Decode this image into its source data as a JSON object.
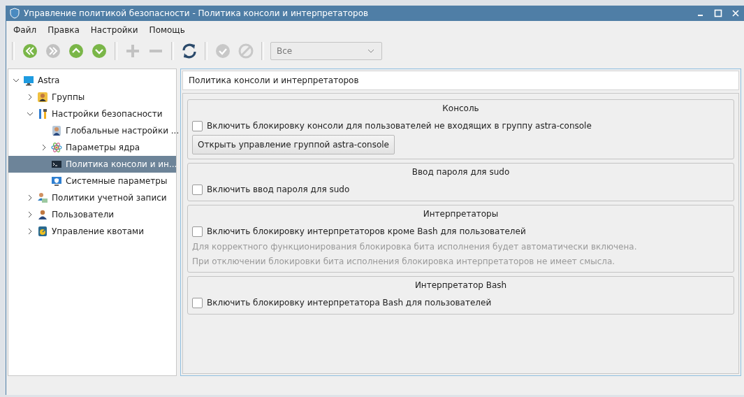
{
  "window": {
    "title": "Управление политикой безопасности - Политика консоли и интерпретаторов"
  },
  "menu": [
    "Файл",
    "Правка",
    "Настройки",
    "Помощь"
  ],
  "toolbar": [
    {
      "kind": "first",
      "disabled": false
    },
    {
      "kind": "next",
      "disabled": true
    },
    {
      "kind": "up",
      "disabled": false
    },
    {
      "kind": "down",
      "disabled": false
    },
    {
      "kind": "sep"
    },
    {
      "kind": "add",
      "disabled": true
    },
    {
      "kind": "remove",
      "disabled": true
    },
    {
      "kind": "sep"
    },
    {
      "kind": "refresh",
      "disabled": false
    },
    {
      "kind": "sep"
    },
    {
      "kind": "apply",
      "disabled": true
    },
    {
      "kind": "cancel",
      "disabled": true
    },
    {
      "kind": "sep"
    }
  ],
  "filter": {
    "value": "Все"
  },
  "tree": [
    {
      "label": "Astra",
      "kind": "monitor",
      "expanded": true,
      "selected": false,
      "children": [
        {
          "label": "Группы",
          "kind": "group",
          "expanded": false,
          "selected": false
        },
        {
          "label": "Настройки безопасности",
          "kind": "tools",
          "expanded": true,
          "selected": false,
          "children": [
            {
              "label": "Глобальные настройки ...",
              "kind": "person",
              "selected": false
            },
            {
              "label": "Параметры ядра",
              "kind": "atom",
              "expanded": false,
              "selected": false
            },
            {
              "label": "Политика консоли и ин...",
              "kind": "terminal",
              "selected": true
            },
            {
              "label": "Системные параметры",
              "kind": "shield",
              "selected": false
            }
          ]
        },
        {
          "label": "Политики учетной записи",
          "kind": "account",
          "expanded": false,
          "selected": false
        },
        {
          "label": "Пользователи",
          "kind": "users",
          "expanded": false,
          "selected": false
        },
        {
          "label": "Управление квотами",
          "kind": "quota",
          "expanded": false,
          "selected": false
        }
      ]
    }
  ],
  "page_title": "Политика консоли и интерпретаторов",
  "sections": [
    {
      "title": "Консоль",
      "items": [
        {
          "kind": "checkbox",
          "label": "Включить блокировку консоли для пользователей не входящих в группу astra-console",
          "checked": false
        },
        {
          "kind": "button",
          "label": "Открыть управление группой astra-console"
        }
      ]
    },
    {
      "title": "Ввод пароля для sudo",
      "items": [
        {
          "kind": "checkbox",
          "label": "Включить ввод пароля для sudo",
          "checked": false
        }
      ]
    },
    {
      "title": "Интерпретаторы",
      "items": [
        {
          "kind": "checkbox",
          "label": "Включить блокировку интерпретаторов кроме Bash для пользователей",
          "checked": false
        },
        {
          "kind": "note",
          "label": "Для корректного функционирования блокировка бита исполнения будет автоматически включена."
        },
        {
          "kind": "note",
          "label": "При отключении блокировки бита исполнения блокировка интерпретаторов не имеет смысла."
        }
      ]
    },
    {
      "title": "Интерпретатор Bash",
      "items": [
        {
          "kind": "checkbox",
          "label": "Включить блокировку интерпретатора Bash для пользователей",
          "checked": false
        }
      ]
    }
  ]
}
